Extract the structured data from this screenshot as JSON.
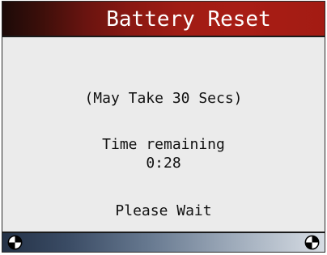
{
  "header": {
    "title": "Battery Reset"
  },
  "main": {
    "note": "(May Take 30 Secs)",
    "time_label": "Time remaining",
    "time_value": "0:28",
    "status": "Please Wait"
  },
  "footer": {
    "left_icon": "circle-quadrant-icon",
    "right_icon": "circle-quadrant-icon"
  },
  "colors": {
    "title_bar": "#a01c14",
    "content_bg": "#ebebeb",
    "footer_bar": "#66788f",
    "text": "#111111"
  }
}
